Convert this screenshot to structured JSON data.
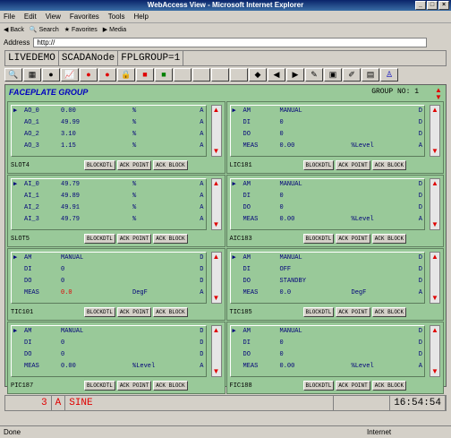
{
  "window": {
    "title": "WebAccess View - Microsoft Internet Explorer"
  },
  "menu": [
    "File",
    "Edit",
    "View",
    "Favorites",
    "Tools",
    "Help"
  ],
  "ietoolbar": {
    "back": "Back",
    "search": "Search",
    "favorites": "Favorites",
    "media": "Media"
  },
  "address": {
    "label": "Address",
    "value": "http://"
  },
  "app": {
    "node": "LIVEDEMO",
    "nodename": "SCADANode",
    "group": "FPLGROUP=1"
  },
  "faceplate": {
    "title": "FACEPLATE GROUP",
    "group_no": "GROUP NO: 1"
  },
  "buttons": {
    "blockdtl": "BLOCKDTL",
    "ack_point": "ACK POINT",
    "ack_block": "ACK BLOCK"
  },
  "panels": [
    {
      "tag": "SLOT4",
      "rows": [
        [
          "AO_0",
          "0.00",
          "%",
          "A"
        ],
        [
          "AO_1",
          "49.99",
          "%",
          "A"
        ],
        [
          "AO_2",
          "3.10",
          "%",
          "A"
        ],
        [
          "AO_3",
          "1.15",
          "%",
          "A"
        ]
      ]
    },
    {
      "tag": "LIC181",
      "rows": [
        [
          "AM",
          "MANUAL",
          "",
          "D"
        ],
        [
          "DI",
          "0",
          "",
          "D"
        ],
        [
          "DO",
          "0",
          "",
          "D"
        ],
        [
          "MEAS",
          "0.00",
          "%Level",
          "A"
        ]
      ]
    },
    {
      "tag": "SLOT5",
      "rows": [
        [
          "AI_0",
          "49.79",
          "%",
          "A"
        ],
        [
          "AI_1",
          "49.89",
          "%",
          "A"
        ],
        [
          "AI_2",
          "49.91",
          "%",
          "A"
        ],
        [
          "AI_3",
          "49.79",
          "%",
          "A"
        ]
      ]
    },
    {
      "tag": "AIC183",
      "rows": [
        [
          "AM",
          "MANUAL",
          "",
          "D"
        ],
        [
          "DI",
          "0",
          "",
          "D"
        ],
        [
          "DO",
          "0",
          "",
          "D"
        ],
        [
          "MEAS",
          "0.00",
          "%Level",
          "A"
        ]
      ]
    },
    {
      "tag": "TIC101",
      "rows": [
        [
          "AM",
          "MANUAL",
          "",
          "D"
        ],
        [
          "DI",
          "0",
          "",
          "D"
        ],
        [
          "DO",
          "0",
          "",
          "D"
        ],
        [
          "MEAS",
          "0.0",
          "DegF",
          "A"
        ]
      ]
    },
    {
      "tag": "TIC185",
      "rows": [
        [
          "AM",
          "MANUAL",
          "",
          "D"
        ],
        [
          "DI",
          "OFF",
          "",
          "D"
        ],
        [
          "DO",
          "STANDBY",
          "",
          "D"
        ],
        [
          "MEAS",
          "0.0",
          "DegF",
          "A"
        ]
      ]
    },
    {
      "tag": "PIC187",
      "rows": [
        [
          "AM",
          "MANUAL",
          "",
          "D"
        ],
        [
          "DI",
          "0",
          "",
          "D"
        ],
        [
          "DO",
          "0",
          "",
          "D"
        ],
        [
          "MEAS",
          "0.00",
          "%Level",
          "A"
        ]
      ]
    },
    {
      "tag": "FIC188",
      "rows": [
        [
          "AM",
          "MANUAL",
          "",
          "D"
        ],
        [
          "DI",
          "0",
          "",
          "D"
        ],
        [
          "DO",
          "0",
          "",
          "D"
        ],
        [
          "MEAS",
          "0.00",
          "%Level",
          "A"
        ]
      ]
    }
  ],
  "status": {
    "alarm_count": "3",
    "alarm_type": "A",
    "alarm_text": "SINE",
    "clock": "16:54:54"
  },
  "iestatus": {
    "left": "Done",
    "zone": "Internet"
  },
  "colors": {
    "value_red": "#e00000"
  }
}
